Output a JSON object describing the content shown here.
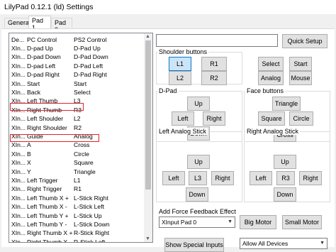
{
  "window": {
    "title": "LilyPad 0.12.1 (ld) Settings"
  },
  "tabs": [
    {
      "label": "General"
    },
    {
      "label": "Pad 1"
    },
    {
      "label": "Pad 2"
    }
  ],
  "bindings": {
    "columns": [
      "De...",
      "PC Control",
      "PS2 Control"
    ],
    "rows": [
      [
        "XIn...",
        "D-pad Up",
        "D-Pad Up"
      ],
      [
        "XIn...",
        "D-pad Down",
        "D-Pad Down"
      ],
      [
        "XIn...",
        "D-pad Left",
        "D-Pad Left"
      ],
      [
        "XIn...",
        "D-pad Right",
        "D-Pad Right"
      ],
      [
        "XIn...",
        "Start",
        "Start"
      ],
      [
        "XIn...",
        "Back",
        "Select"
      ],
      [
        "XIn...",
        "Left Thumb",
        "L3"
      ],
      [
        "XIn...",
        "Right Thumb",
        "R3"
      ],
      [
        "XIn...",
        "Left Shoulder",
        "L2"
      ],
      [
        "XIn...",
        "Right Shoulder",
        "R2"
      ],
      [
        "XIn...",
        "Guide",
        "Analog"
      ],
      [
        "XIn...",
        "A",
        "Cross"
      ],
      [
        "XIn...",
        "B",
        "Circle"
      ],
      [
        "XIn...",
        "X",
        "Square"
      ],
      [
        "XIn...",
        "Y",
        "Triangle"
      ],
      [
        "XIn...",
        "Left Trigger",
        "L1"
      ],
      [
        "XIn...",
        "Right Trigger",
        "R1"
      ],
      [
        "XIn...",
        "Left Thumb X +",
        "L-Stick Right"
      ],
      [
        "XIn...",
        "Left Thumb X -",
        "L-Stick Left"
      ],
      [
        "XIn...",
        "Left Thumb Y +",
        "L-Stick Up"
      ],
      [
        "XIn...",
        "Left Thumb Y -",
        "L-Stick Down"
      ],
      [
        "XIn...",
        "Right Thumb X +",
        "R-Stick Right"
      ],
      [
        "XIn...",
        "Right Thumb X -",
        "R-Stick Left"
      ],
      [
        "XIn...",
        "Right Thumb Y +",
        "R-Stick Up"
      ],
      [
        "XIn...",
        "Right Thumb Y -",
        "R-Stick Down"
      ]
    ]
  },
  "right": {
    "quick_setup": "Quick Setup",
    "shoulder": {
      "label": "Shoulder buttons",
      "l1": "L1",
      "r1": "R1",
      "l2": "L2",
      "r2": "R2"
    },
    "misc": {
      "select": "Select",
      "start": "Start",
      "analog": "Analog",
      "mouse": "Mouse"
    },
    "dpad": {
      "label": "D-Pad",
      "up": "Up",
      "left": "Left",
      "right": "Right",
      "down": "Down"
    },
    "face": {
      "label": "Face buttons",
      "triangle": "Triangle",
      "square": "Square",
      "circle": "Circle",
      "cross": "Cross"
    },
    "left_stick": {
      "label": "Left Analog Stick",
      "up": "Up",
      "left": "Left",
      "center": "L3",
      "right": "Right",
      "down": "Down"
    },
    "right_stick": {
      "label": "Right Analog Stick",
      "up": "Up",
      "left": "Left",
      "center": "R3",
      "right": "Right",
      "down": "Down"
    },
    "force_feedback": {
      "label": "Add Force Feedback Effect",
      "device": "XInput Pad 0",
      "big_motor": "Big Motor",
      "small_motor": "Small Motor"
    },
    "show_special": "Show Special Inputs",
    "device_filter": "Allow All Devices"
  }
}
